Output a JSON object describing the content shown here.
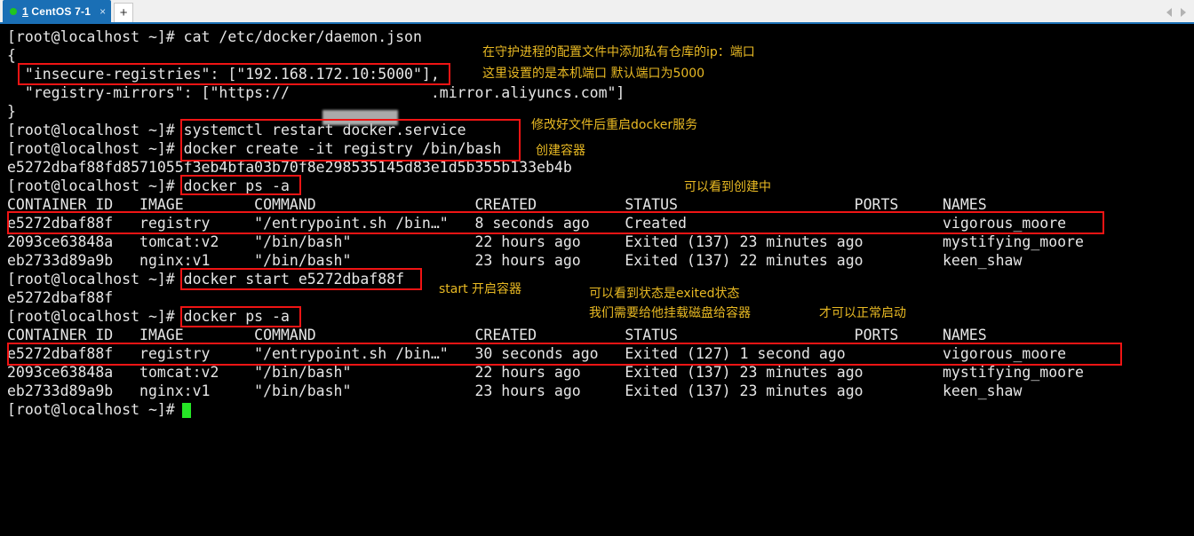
{
  "window": {
    "tab": {
      "number": "1",
      "title": " CentOS 7-1",
      "close_label": "×",
      "status_color": "#21c521",
      "active_color": "#1a6fb5"
    },
    "new_tab_label": "+",
    "nav_prev_icon": "chevron-left-icon",
    "nav_next_icon": "chevron-right-icon"
  },
  "terminal": {
    "prompt": "[root@localhost ~]#",
    "foreground": "#e6e6e6",
    "background": "#000000",
    "cursor_color": "#26e626",
    "lines": [
      {
        "id": "l01",
        "text": "[root@localhost ~]# cat /etc/docker/daemon.json"
      },
      {
        "id": "l02",
        "text": "{"
      },
      {
        "id": "l03",
        "text": "  \"insecure-registries\": [\"192.168.172.10:5000\"],"
      },
      {
        "id": "l04",
        "text": "  \"registry-mirrors\": [\"https://                .mirror.aliyuncs.com\"]"
      },
      {
        "id": "l05",
        "text": "}"
      },
      {
        "id": "l06",
        "text": "[root@localhost ~]# systemctl restart docker.service"
      },
      {
        "id": "l07",
        "text": "[root@localhost ~]# docker create -it registry /bin/bash"
      },
      {
        "id": "l08",
        "text": "e5272dbaf88fd8571055f3eb4bfa03b70f8e298535145d83e1d5b355b133eb4b"
      },
      {
        "id": "l09",
        "text": "[root@localhost ~]# docker ps -a"
      },
      {
        "id": "l10",
        "text": "CONTAINER ID   IMAGE        COMMAND                  CREATED          STATUS                    PORTS     NAMES"
      },
      {
        "id": "l11",
        "text": "e5272dbaf88f   registry     \"/entrypoint.sh /bin…\"   8 seconds ago    Created                             vigorous_moore"
      },
      {
        "id": "l12",
        "text": "2093ce63848a   tomcat:v2    \"/bin/bash\"              22 hours ago     Exited (137) 23 minutes ago         mystifying_moore"
      },
      {
        "id": "l13",
        "text": "eb2733d89a9b   nginx:v1     \"/bin/bash\"              23 hours ago     Exited (137) 22 minutes ago         keen_shaw"
      },
      {
        "id": "l14",
        "text": "[root@localhost ~]# docker start e5272dbaf88f"
      },
      {
        "id": "l15",
        "text": "e5272dbaf88f"
      },
      {
        "id": "l16",
        "text": "[root@localhost ~]# docker ps -a"
      },
      {
        "id": "l17",
        "text": "CONTAINER ID   IMAGE        COMMAND                  CREATED          STATUS                    PORTS     NAMES"
      },
      {
        "id": "l18",
        "text": "e5272dbaf88f   registry     \"/entrypoint.sh /bin…\"   30 seconds ago   Exited (127) 1 second ago           vigorous_moore"
      },
      {
        "id": "l19",
        "text": "2093ce63848a   tomcat:v2    \"/bin/bash\"              22 hours ago     Exited (137) 23 minutes ago         mystifying_moore"
      },
      {
        "id": "l20",
        "text": "eb2733d89a9b   nginx:v1     \"/bin/bash\"              23 hours ago     Exited (137) 23 minutes ago         keen_shaw"
      },
      {
        "id": "l21",
        "text": "[root@localhost ~]# "
      }
    ],
    "annotations": [
      {
        "id": "a1",
        "text": "在守护进程的配置文件中添加私有仓库的ip：端口"
      },
      {
        "id": "a2",
        "text": "这里设置的是本机端口 默认端口为5000"
      },
      {
        "id": "a3",
        "text": "修改好文件后重启docker服务"
      },
      {
        "id": "a4",
        "text": "创建容器"
      },
      {
        "id": "a5",
        "text": "可以看到创建中"
      },
      {
        "id": "a6",
        "text": "start 开启容器"
      },
      {
        "id": "a7",
        "text": "可以看到状态是exited状态"
      },
      {
        "id": "a8",
        "text": "我们需要给他挂载磁盘给容器"
      },
      {
        "id": "a9",
        "text": "才可以正常启动"
      }
    ],
    "highlight_color": "#f01414"
  }
}
